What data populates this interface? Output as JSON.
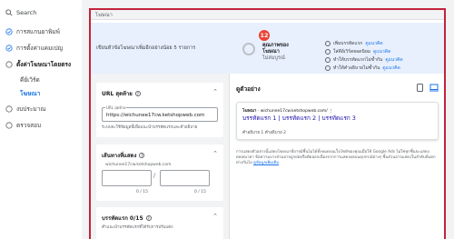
{
  "sidebar": {
    "search": "Search",
    "items": [
      {
        "label": "การสแกนยาพิมพ์"
      },
      {
        "label": "การตั้งค่าแคมเปญ"
      },
      {
        "label": "ตั้งค่าโฆษณาโดยตรง"
      },
      {
        "label": "คีย์เวิร์ด"
      },
      {
        "label": "โฆษณา"
      },
      {
        "label": "งบประมาณ"
      },
      {
        "label": "ตรวจสอบ"
      }
    ]
  },
  "frame": {
    "header_title": "โฆษณา"
  },
  "strength": {
    "badge": "12",
    "prompt": "เขียนหัวข้อโฆษณาเพิ่มอีกอย่างน้อย 5 รายการ",
    "label_line1": "คุณภาพของ",
    "label_line2": "โฆษณา",
    "status": "ไม่สมบูรณ์",
    "checklist": [
      {
        "text": "เพิ่มบรรทัดแรก",
        "link": "ดูแนวคิด"
      },
      {
        "text": "ใส่คีย์เวิร์ดยอดนิยม",
        "link": "ดูแนวคิด"
      },
      {
        "text": "ทำให้บรรทัดแรกไม่ซ้ำกัน",
        "link": "ดูแนวคิด"
      },
      {
        "text": "ทำให้คำอธิบายไม่ซ้ำกัน",
        "link": "ดูแนวคิด"
      }
    ]
  },
  "cards": {
    "url": {
      "title": "URL สุดท้าย",
      "field_label": "URL สุดท้าย",
      "value": "https://wichunee17cw.ketshopweb.com",
      "note": "ระบบจะใช้ข้อมูลนี้เพื่อแนะนำบรรทัดแรกและคำอธิบาย"
    },
    "path": {
      "title": "เส้นทางที่แสดง",
      "domain": "wichunee17cw.ketshopweb.com",
      "slash": "/",
      "counter1": "0 / 15",
      "counter2": "0 / 15"
    },
    "headlines": {
      "title": "บรรทัดแรก 0/15",
      "note": "คำแนะนำบรรทัดแรกที่ได้รับการปรับแต่ง"
    }
  },
  "preview": {
    "title": "ดูตัวอย่าง",
    "ad_tag": "โฆษณา",
    "display_url": "· wichunee17cw.ketshopweb.com/",
    "headline1": "บรรทัดแรก 1 | บรรทัดแรก 2 | บรรทัดแรก 3",
    "headline2": "",
    "description": "คำอธิบาย 1 คำอธิบาย 2",
    "disclaimer": "การแสดงตัวอย่างนี้แสดงโฆษณาที่อาจมีชิ้นไม่ได้ทั้งหมดบนเว็บไซต์ของคุณเมื่อใช้ Google Ads ไม่ใช่ทุกชิ้นจะแสดงตลอดเวลา ข้อความบางส่วนอาจถูกย่อหรือตัดออกเนื่องจากการแสดงผลบนอุปกรณ์ต่างๆ ชิ้นส่วนอาจแสดงในลำดับที่แตกต่างกันไป",
    "disclaimer_link": "ดูข้อมูลเพิ่มเติม"
  }
}
